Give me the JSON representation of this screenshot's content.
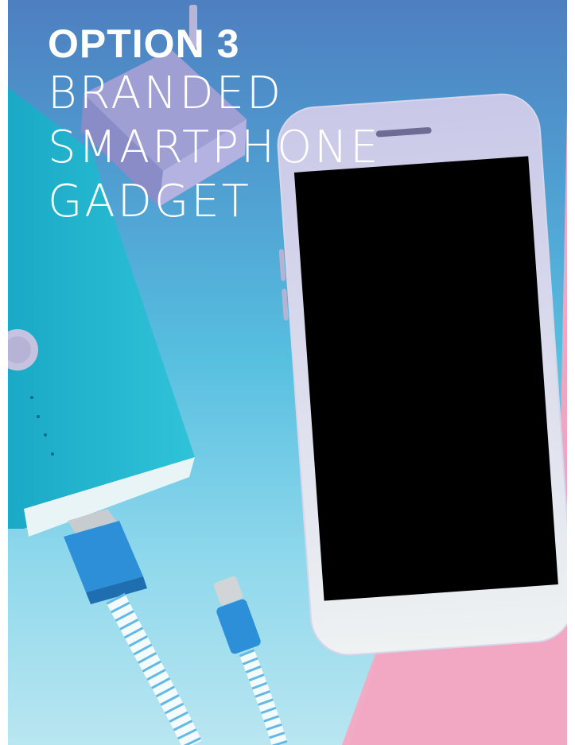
{
  "headline": {
    "kicker": "OPTION 3",
    "title_lines": [
      "BRANDED",
      "SMARTPHONE",
      "GADGET"
    ]
  },
  "palette": {
    "background_top": "#4e7fc0",
    "background_bottom": "#b9e6f1",
    "powerbank": "#23b7cf",
    "cable_head": "#2d8fd8",
    "phone_frame": "#e8e4f0",
    "phone_screen": "#000000",
    "pink_paper": "#f0a9c4",
    "text": "#ffffff"
  },
  "scene": {
    "objects": [
      "wall-charger",
      "power-bank",
      "usb-cable",
      "micro-usb-cable",
      "smartphone"
    ]
  }
}
